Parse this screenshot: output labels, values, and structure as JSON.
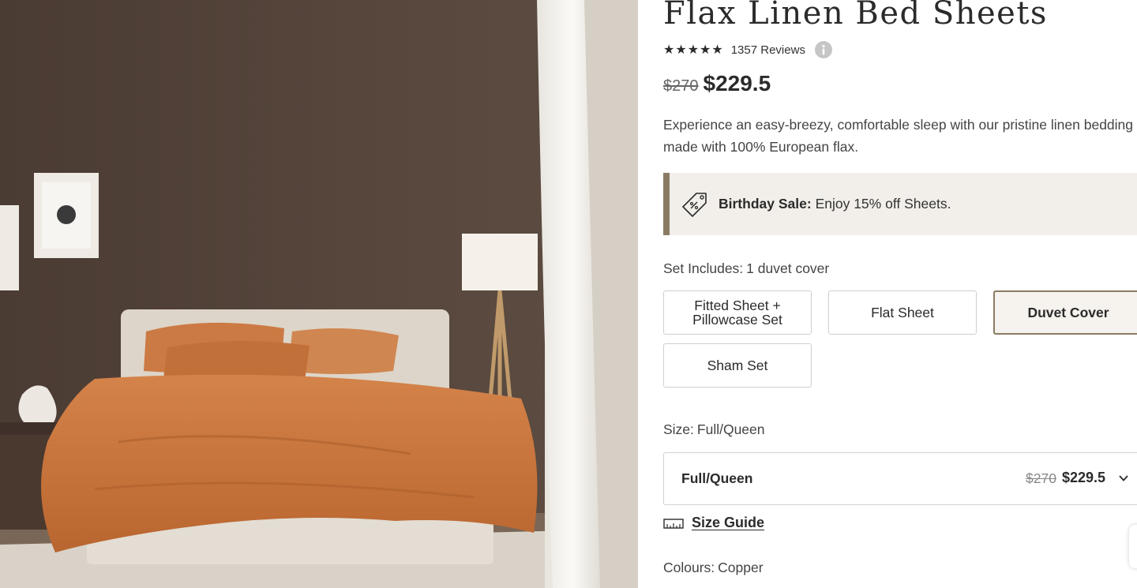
{
  "product": {
    "title": "Flax Linen Bed Sheets",
    "rating_stars": 5,
    "reviews_label": "1357 Reviews",
    "original_price": "$270",
    "sale_price": "$229.5",
    "description": "Experience an easy-breezy, comfortable sleep with our pristine linen bedding made with 100% European flax."
  },
  "sale_banner": {
    "icon": "price-tag-icon",
    "bold_text": "Birthday Sale:",
    "text": "Enjoy 15% off Sheets."
  },
  "set_includes": {
    "label": "Set Includes:",
    "value": "1 duvet cover",
    "options": [
      {
        "line1": "Fitted Sheet +",
        "line2": "Pillowcase Set",
        "selected": false
      },
      {
        "label": "Flat Sheet",
        "selected": false
      },
      {
        "label": "Duvet Cover",
        "selected": true
      },
      {
        "label": "Sham Set",
        "selected": false
      }
    ]
  },
  "size": {
    "label": "Size:",
    "value": "Full/Queen",
    "select": {
      "selected": "Full/Queen",
      "original_price": "$270",
      "sale_price": "$229.5"
    },
    "guide_label": "Size Guide"
  },
  "colours": {
    "label": "Colours:",
    "value": "Copper"
  },
  "icons": {
    "rating": "star-icon",
    "info": "info-icon",
    "select": "chevron-down-icon",
    "size_guide": "ruler-icon"
  },
  "colors": {
    "accent": "#8a7b63",
    "banner_bg": "#f2efea",
    "text": "#2b2b2b",
    "wall": "#53433a",
    "duvet": "#c8743a"
  }
}
